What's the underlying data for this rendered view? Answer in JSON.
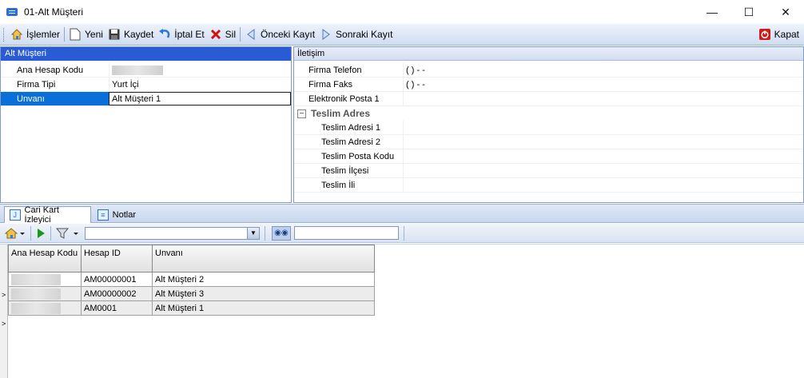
{
  "window": {
    "title": "01-Alt Müşteri",
    "minimize": "—",
    "maximize": "☐",
    "close": "✕"
  },
  "toolbar": {
    "items": [
      {
        "label": "İşlemler",
        "icon": "home-icon"
      },
      {
        "label": "Yeni",
        "icon": "new-document-icon"
      },
      {
        "label": "Kaydet",
        "icon": "save-icon"
      },
      {
        "label": "İptal Et",
        "icon": "undo-icon"
      },
      {
        "label": "Sil",
        "icon": "delete-icon"
      },
      {
        "label": "Önceki Kayıt",
        "icon": "previous-icon"
      },
      {
        "label": "Sonraki Kayıt",
        "icon": "next-icon"
      }
    ],
    "close_label": "Kapat"
  },
  "left_panel": {
    "header": "Alt Müşteri",
    "rows": [
      {
        "label": "Ana Hesap Kodu",
        "value": ""
      },
      {
        "label": "Firma Tipi",
        "value": "Yurt İçi"
      },
      {
        "label": "Unvanı",
        "value": "Alt Müşteri 1"
      }
    ]
  },
  "right_panel": {
    "header": "İletişim",
    "rows": [
      {
        "label": "Firma Telefon",
        "value": "(  )  -  -"
      },
      {
        "label": "Firma Faks",
        "value": "(  )  -  -"
      },
      {
        "label": "Elektronik Posta 1",
        "value": ""
      }
    ],
    "category": {
      "toggle": "−",
      "label": "Teslim Adres"
    },
    "sub_rows": [
      {
        "label": "Teslim Adresi 1",
        "value": ""
      },
      {
        "label": "Teslim Adresi 2",
        "value": ""
      },
      {
        "label": "Teslim Posta Kodu",
        "value": ""
      },
      {
        "label": "Teslim İlçesi",
        "value": ""
      },
      {
        "label": "Teslim İli",
        "value": ""
      }
    ]
  },
  "tabs": [
    {
      "label": "Cari Kart İzleyici",
      "icon": "card-icon"
    },
    {
      "label": "Notlar",
      "icon": "notes-icon"
    }
  ],
  "grid_toolbar": {
    "filter_value": "",
    "search_value": ""
  },
  "grid": {
    "columns": [
      "Ana Hesap Kodu",
      "Hesap ID",
      "Unvanı"
    ],
    "rows": [
      {
        "code": "",
        "id": "AM00000001",
        "name": "Alt Müşteri 2"
      },
      {
        "code": "",
        "id": "AM00000002",
        "name": "Alt Müşteri 3"
      },
      {
        "code": "",
        "id": "AM0001",
        "name": "Alt Müşteri 1"
      }
    ]
  },
  "colors": {
    "selection": "#0a6fd8",
    "panel_header_active": "#2a5bd7",
    "toolbar_gradient_top": "#eef3fb",
    "toolbar_gradient_bottom": "#cfdcf1",
    "delete_red": "#d01010",
    "play_green": "#1a9a1a"
  }
}
